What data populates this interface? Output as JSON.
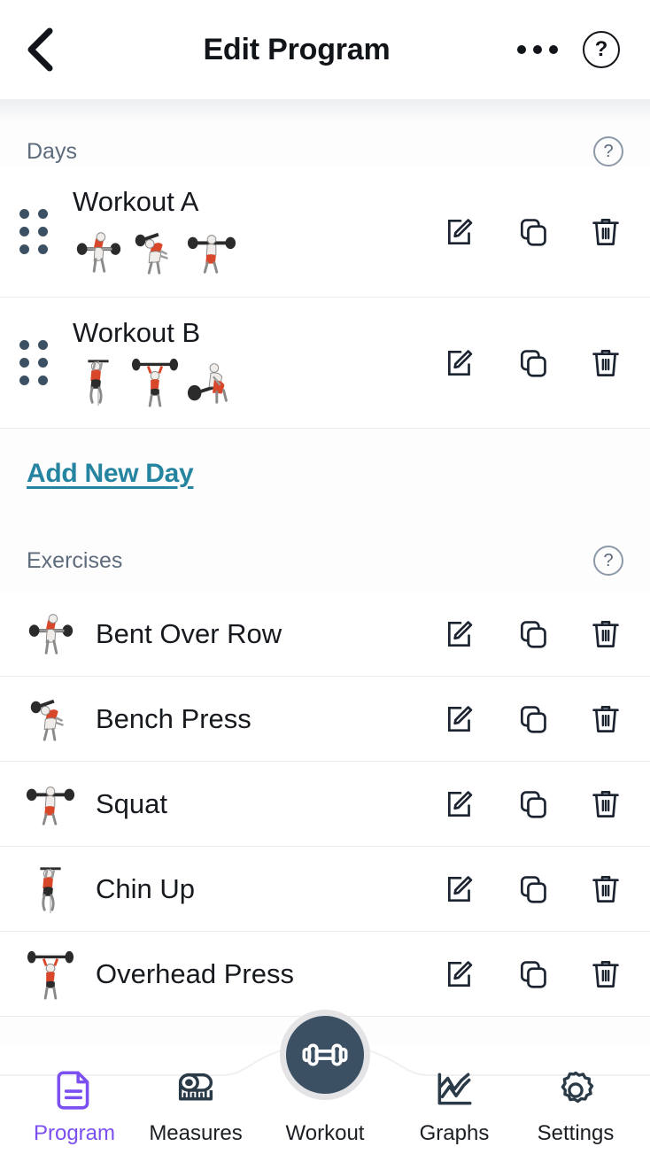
{
  "header": {
    "back_icon": "chevron-left-icon",
    "title": "Edit Program",
    "overflow_icon": "more-options-icon",
    "help_icon": "help-circle-icon",
    "help_label": "?"
  },
  "sections": {
    "days": {
      "title": "Days",
      "help_label": "?",
      "rows": [
        {
          "name": "Workout A",
          "thumbnails": [
            "bent-over-row-thumb",
            "bench-press-thumb",
            "squat-thumb"
          ],
          "edit_label": "edit-icon",
          "copy_label": "copy-icon",
          "delete_label": "trash-icon"
        },
        {
          "name": "Workout B",
          "thumbnails": [
            "chin-up-thumb",
            "overhead-press-thumb",
            "bent-over-row-thumb"
          ],
          "edit_label": "edit-icon",
          "copy_label": "copy-icon",
          "delete_label": "trash-icon"
        }
      ],
      "add_link": "Add New Day"
    },
    "exercises": {
      "title": "Exercises",
      "help_label": "?",
      "rows": [
        {
          "name": "Bent Over Row",
          "thumb": "bent-over-row-thumb"
        },
        {
          "name": "Bench Press",
          "thumb": "bench-press-thumb"
        },
        {
          "name": "Squat",
          "thumb": "squat-thumb"
        },
        {
          "name": "Chin Up",
          "thumb": "chin-up-thumb"
        },
        {
          "name": "Overhead Press",
          "thumb": "overhead-press-thumb"
        }
      ]
    }
  },
  "bottom_nav": {
    "items": [
      {
        "label": "Program",
        "icon": "document-icon",
        "active": true
      },
      {
        "label": "Measures",
        "icon": "tape-measure-icon",
        "active": false
      },
      {
        "label": "Workout",
        "icon": "dumbbell-icon",
        "active": false,
        "center": true
      },
      {
        "label": "Graphs",
        "icon": "line-chart-icon",
        "active": false
      },
      {
        "label": "Settings",
        "icon": "gear-icon",
        "active": false
      }
    ]
  },
  "colors": {
    "accent_link": "#2584a0",
    "active_nav": "#7b4ff0",
    "section_title": "#5d6b7c",
    "fab_bg": "#3c5063",
    "icon_dark": "#1b2430",
    "muscle_highlight": "#d9472b"
  }
}
